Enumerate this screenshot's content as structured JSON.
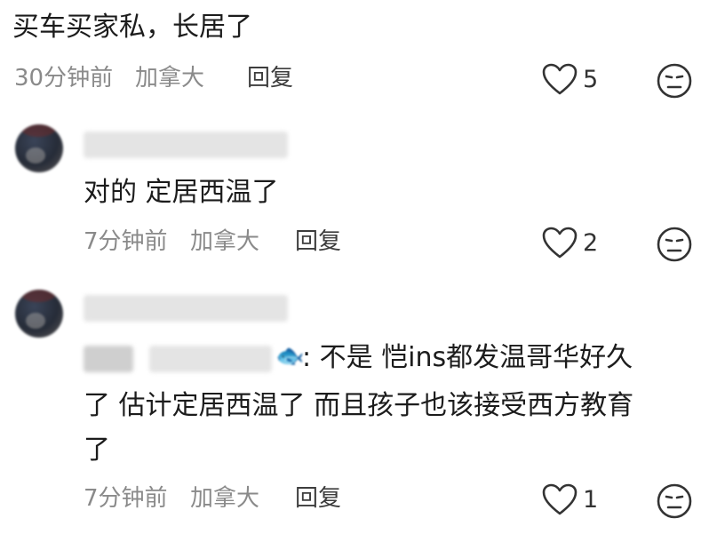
{
  "top_comment": {
    "text": "买车买家私，长居了",
    "time": "30分钟前",
    "location": "加拿大",
    "reply_label": "回复",
    "likes": "5"
  },
  "reply1": {
    "text": "对的 定居西温了",
    "time": "7分钟前",
    "location": "加拿大",
    "reply_label": "回复",
    "likes": "2"
  },
  "reply2": {
    "text_line1": ": 不是 恺ins都发温哥华好久",
    "text_line2": "了 估计定居西温了 而且孩子也该接受西方教育",
    "text_line3": "了",
    "time": "7分钟前",
    "location": "加拿大",
    "reply_label": "回复",
    "likes": "1",
    "fish_icon": "fish-emoji"
  },
  "icons": {
    "like": "heart-outline-icon",
    "dislike": "neutral-face-icon"
  }
}
